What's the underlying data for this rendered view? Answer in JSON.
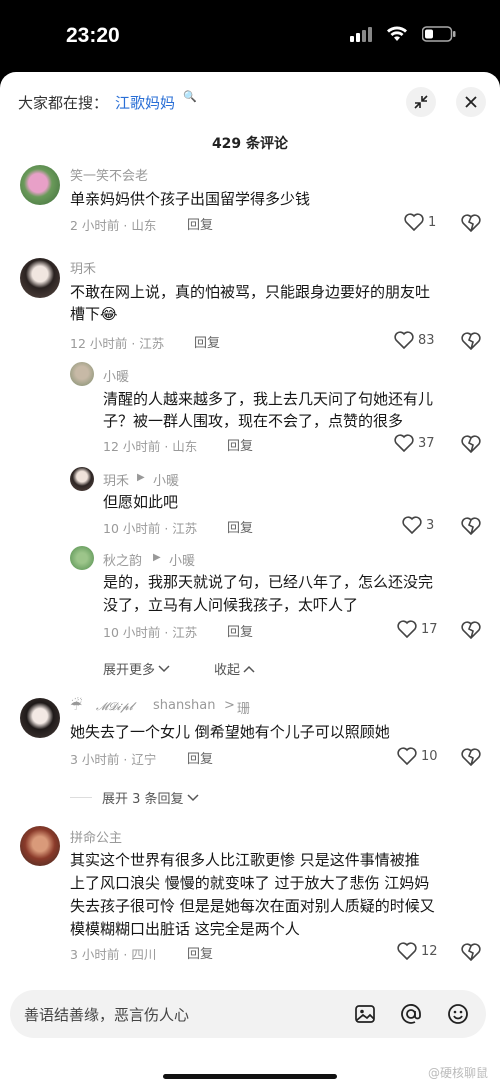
{
  "status_bar": {
    "time": "23:20"
  },
  "search": {
    "prefix": "大家都在搜：",
    "query": "江歌妈妈",
    "query_icon": "🔍"
  },
  "comments_header": "429 条评论",
  "comments": [
    {
      "user": "笑一笑不会老",
      "text": "单亲妈妈供个孩子出国留学得多少钱",
      "meta": "2 小时前 · 山东",
      "reply_label": "回复",
      "likes": "1"
    },
    {
      "user": "玥禾",
      "text_line1": "不敢在网上说，真的怕被骂，只能跟身边要好的朋友吐",
      "text_line2": "槽下😂",
      "meta": "12 小时前 · 江苏",
      "reply_label": "回复",
      "likes": "83"
    },
    {
      "user": "小暖",
      "text_line1": "清醒的人越来越多了，我上去几天问了句她还有儿",
      "text_line2": "子？被一群人围攻，现在不会了，点赞的很多",
      "meta": "12 小时前 · 山东",
      "reply_label": "回复",
      "likes": "37"
    },
    {
      "user": "玥禾",
      "reply_arrow": "▶",
      "reply_to": "小暖",
      "text": "但愿如此吧",
      "meta": "10 小时前 · 江苏",
      "reply_label": "回复",
      "likes": "3"
    },
    {
      "user": "秋之韵",
      "reply_arrow": "▶",
      "reply_to": "小暖",
      "text_line1": "是的，我那天就说了句，已经八年了，怎么还没完",
      "text_line2": "没了，立马有人问候我孩子，太吓人了",
      "meta": "10 小时前 · 江苏",
      "reply_label": "回复",
      "likes": "17"
    },
    {
      "user_prefix": "☔",
      "user_script": "𝓜𝓓𝓲𝓹𝓵",
      "user_mid": "shanshan",
      "reply_arrow": ">",
      "reply_to": "珊",
      "text": "她失去了一个女儿 倒希望她有个儿子可以照顾她",
      "meta": "3 小时前 · 辽宁",
      "reply_label": "回复",
      "likes": "10"
    },
    {
      "user": "拼命公主",
      "text_line1": "其实这个世界有很多人比江歌更惨 只是这件事情被推",
      "text_line2": "上了风口浪尖 慢慢的就变味了 过于放大了悲伤 江妈妈",
      "text_line3": "失去孩子很可怜 但是是她每次在面对别人质疑的时候又",
      "text_line4": "模模糊糊口出脏话 这完全是两个人",
      "meta": "3 小时前 · 四川",
      "reply_label": "回复",
      "likes": "12"
    }
  ],
  "thread_controls": {
    "expand_more": "展开更多",
    "collapse": "收起",
    "expand_replies": "展开 3 条回复"
  },
  "bottom_input": {
    "placeholder": "善语结善缘，恶言伤人心"
  },
  "watermark": "@硬核聊鼠",
  "colors": {
    "link": "#2a6fd6",
    "background": "#ffffff",
    "status_bar": "#000000"
  }
}
